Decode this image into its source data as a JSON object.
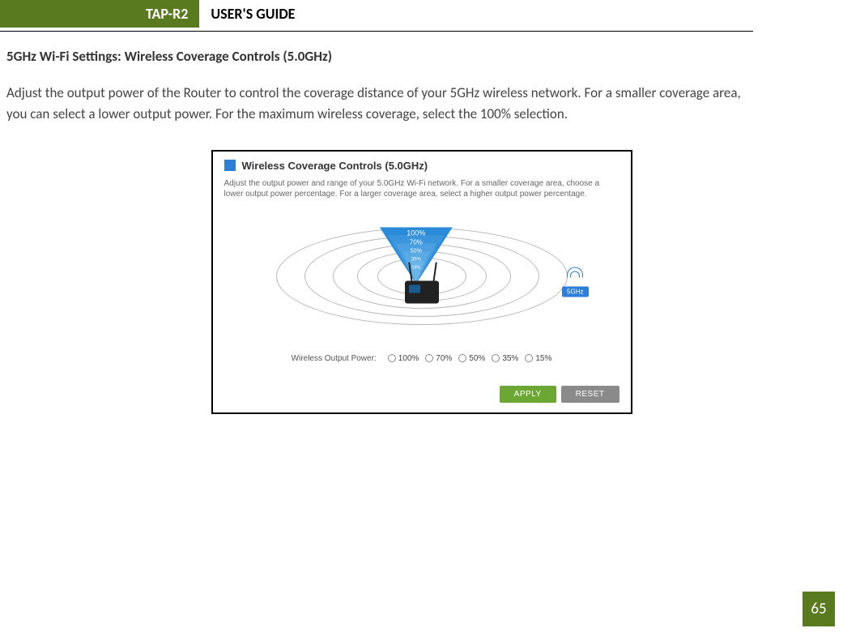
{
  "header": {
    "product_tag": "TAP-R2",
    "guide_title": "USER'S GUIDE"
  },
  "section": {
    "heading": "5GHz Wi-Fi Settings: Wireless Coverage Controls (5.0GHz)",
    "body": "Adjust the output power of the Router to control the coverage distance of your 5GHz wireless network.  For a smaller coverage area, you can select a lower output power. For the maximum wireless coverage, select the 100% selection."
  },
  "panel": {
    "title": "Wireless Coverage Controls (5.0GHz)",
    "description": "Adjust the output power and range of your 5.0GHz Wi-Fi network. For a smaller coverage area, choose a lower output power percentage. For a larger coverage area, select a higher output power percentage.",
    "wedge_labels": [
      "100%",
      "70%",
      "50%",
      "35%",
      "15%"
    ],
    "ghz_label": "5GHz",
    "radio_label": "Wireless Output Power:",
    "radio_options": [
      "100%",
      "70%",
      "50%",
      "35%",
      "15%"
    ],
    "apply_label": "APPLY",
    "reset_label": "RESET"
  },
  "page_number": "65"
}
